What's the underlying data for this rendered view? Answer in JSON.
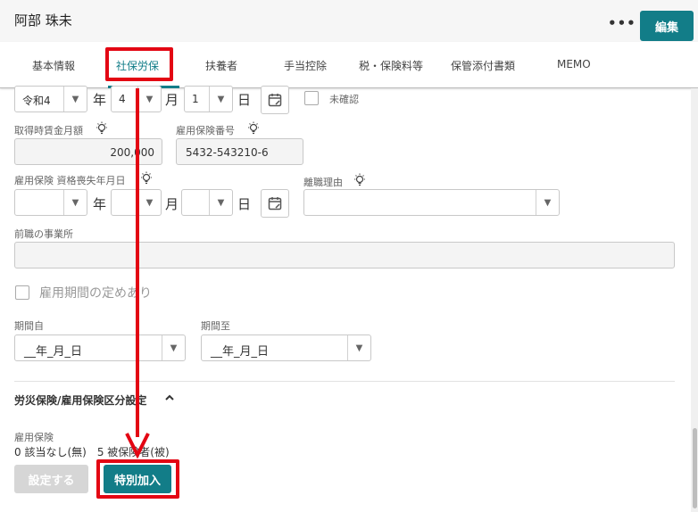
{
  "header": {
    "person_name": "阿部 珠未",
    "more_label": "•••",
    "edit_label": "編集"
  },
  "tabs": [
    {
      "label": "基本情報"
    },
    {
      "label": "社保労保"
    },
    {
      "label": "扶養者"
    },
    {
      "label": "手当控除"
    },
    {
      "label": "税・保険料等"
    },
    {
      "label": "保管添付書類"
    },
    {
      "label": "MEMO"
    }
  ],
  "date_row1": {
    "era": "令和4",
    "year_unit": "年",
    "month": "4",
    "month_unit": "月",
    "day": "1",
    "day_unit": "日",
    "unconfirmed_label": "未確認"
  },
  "salary": {
    "label": "取得時賃金月額",
    "value": "200,000"
  },
  "insurance_number": {
    "label": "雇用保険番号",
    "value": "5432-543210-6"
  },
  "loss_date": {
    "label": "雇用保険 資格喪失年月日",
    "year_unit": "年",
    "month_unit": "月",
    "day_unit": "日"
  },
  "leave_reason": {
    "label": "離職理由"
  },
  "prev_office": {
    "label": "前職の事業所"
  },
  "employment_period": {
    "label": "雇用期間の定めあり"
  },
  "period": {
    "from_label": "期間自",
    "from_value": "__年_月_日",
    "to_label": "期間至",
    "to_value": "__年_月_日"
  },
  "section": {
    "title": "労災保険/雇用保険区分設定",
    "chevron": "^"
  },
  "employment_insurance": {
    "label": "雇用保険",
    "value_text": "0 該当なし(無)　5 被保険者(被)"
  },
  "buttons": {
    "none_label": "設定する",
    "special_label": "特別加入"
  },
  "colors": {
    "accent": "#127d88",
    "highlight": "#e30613"
  }
}
